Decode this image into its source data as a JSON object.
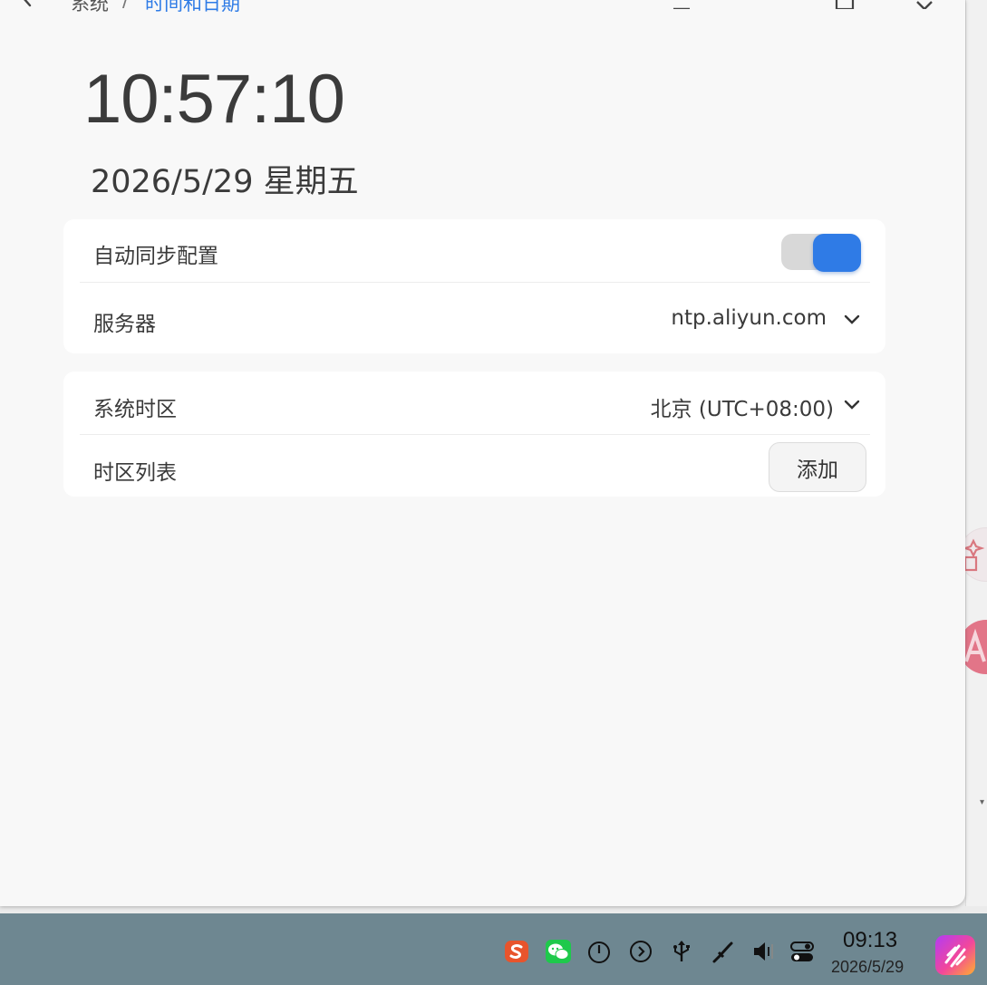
{
  "breadcrumb": {
    "parent": "系统",
    "separator": "/",
    "current": "时间和日期"
  },
  "clock": {
    "time": "10:57:10",
    "date": "2026/5/29 星期五"
  },
  "sync_card": {
    "auto_sync_label": "自动同步配置",
    "auto_sync_enabled": true,
    "server_label": "服务器",
    "server_value": "ntp.aliyun.com"
  },
  "timezone_card": {
    "system_tz_label": "系统时区",
    "system_tz_value": "北京 (UTC+08:00)",
    "tz_list_label": "时区列表",
    "add_button": "添加"
  },
  "taskbar": {
    "time": "09:13",
    "date": "2026/5/29",
    "tray_icons": [
      "sogou-input-icon",
      "wechat-icon",
      "power-icon",
      "forward-circle-icon",
      "usb-icon",
      "pen-icon",
      "volume-icon",
      "toggle-settings-icon"
    ]
  },
  "colors": {
    "accent": "#2f7be6",
    "taskbar": "#6e8791",
    "window_bg": "#f8f8f8"
  }
}
